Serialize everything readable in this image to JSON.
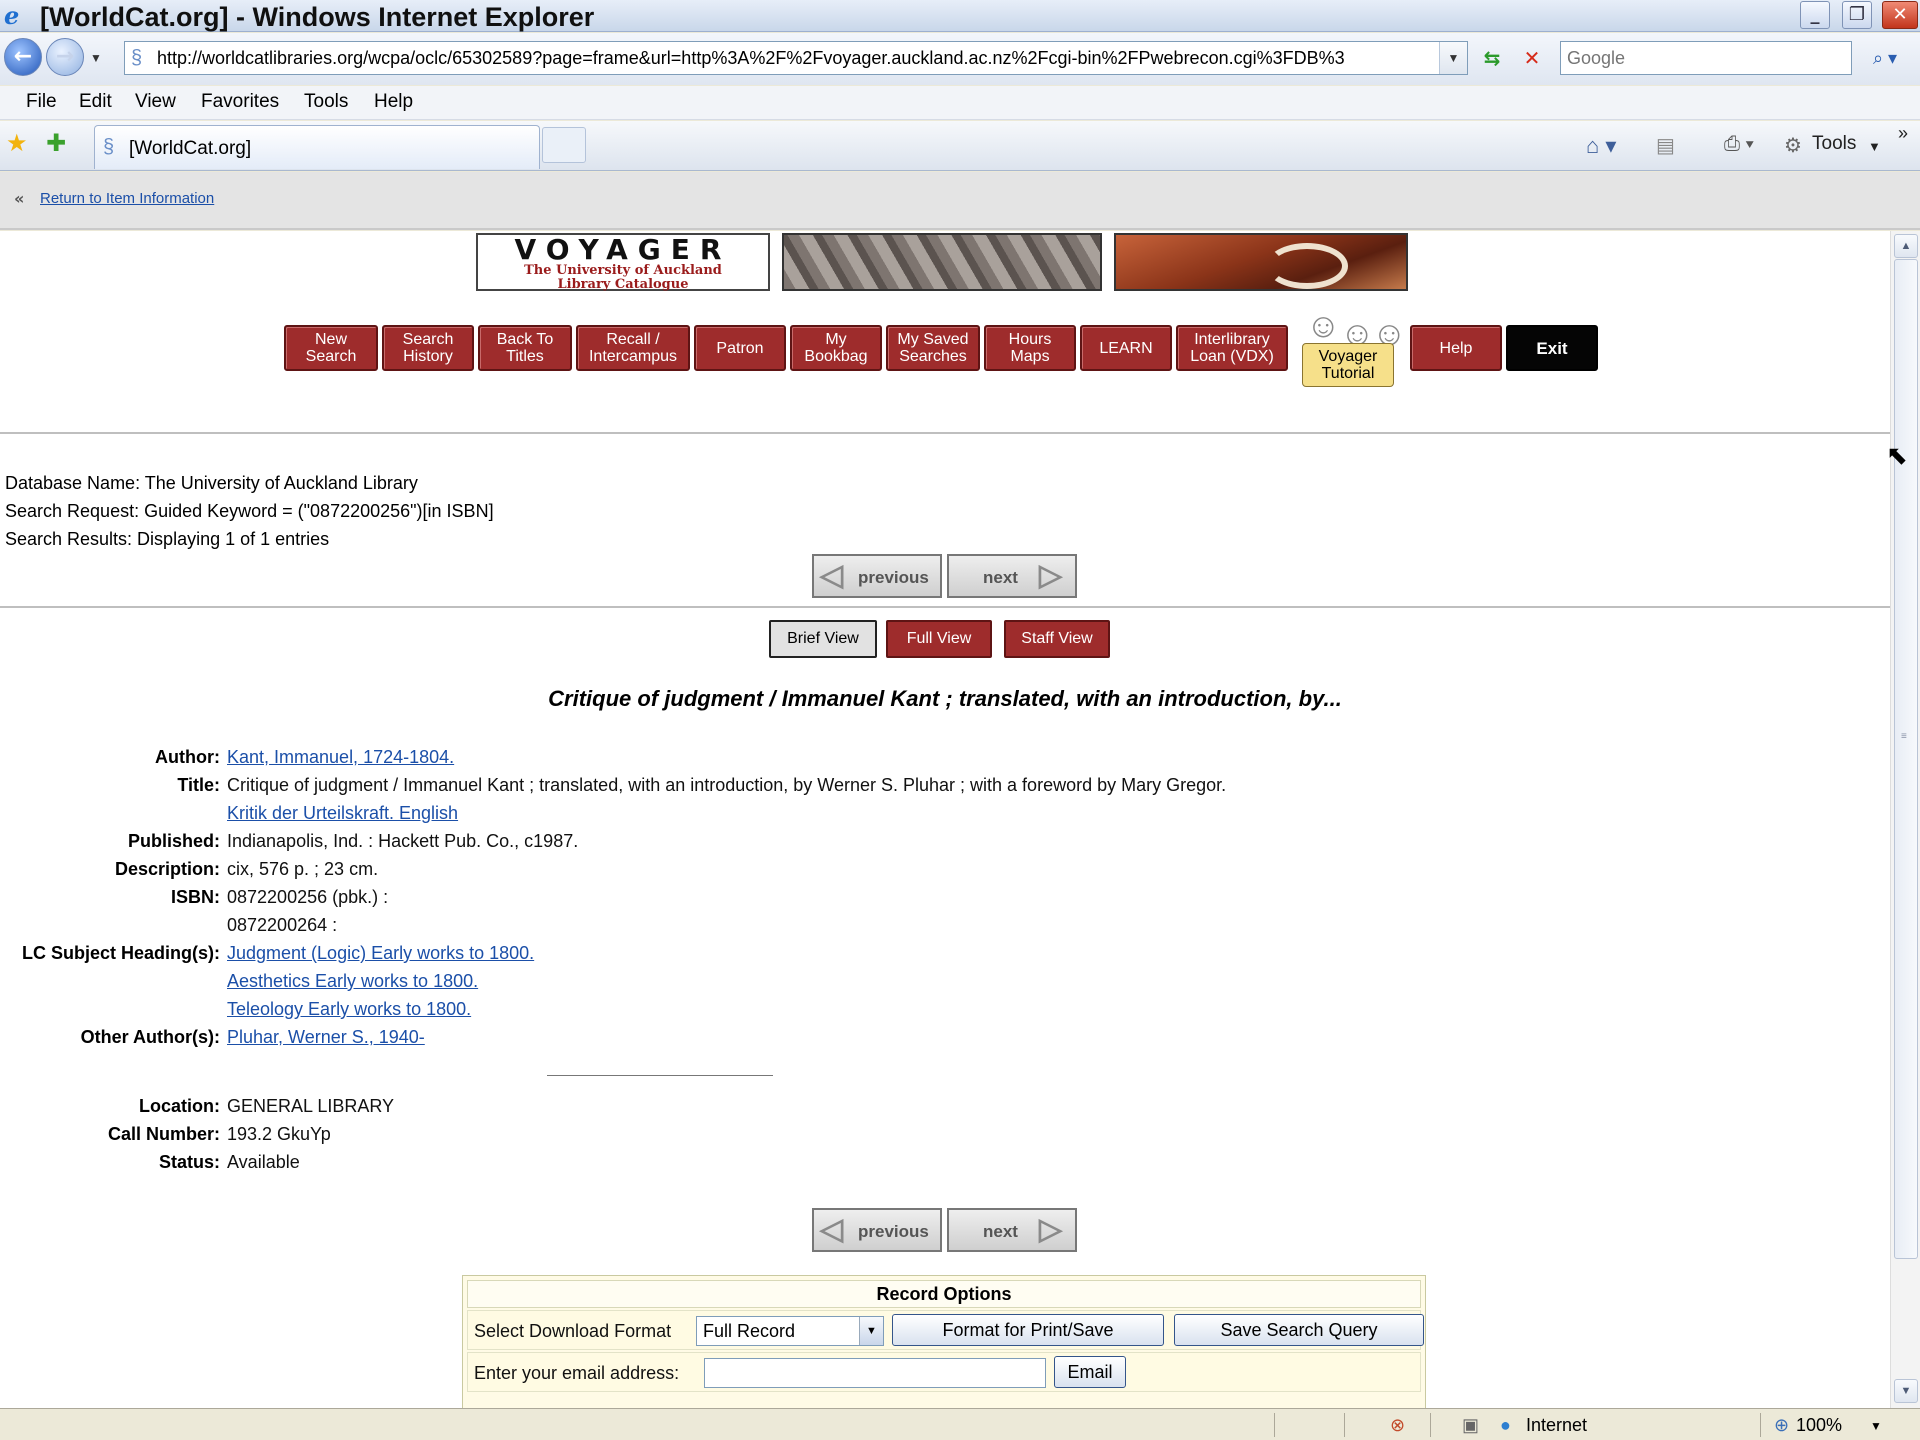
{
  "window": {
    "title": "[WorldCat.org] - Windows Internet Explorer"
  },
  "toolbar": {
    "url": "http://worldcatlibraries.org/wcpa/oclc/65302589?page=frame&url=http%3A%2F%2Fvoyager.auckland.ac.nz%2Fcgi-bin%2FPwebrecon.cgi%3FDB%3",
    "search_placeholder": "Google"
  },
  "menu": [
    "File",
    "Edit",
    "View",
    "Favorites",
    "Tools",
    "Help"
  ],
  "tab": {
    "label": "[WorldCat.org]"
  },
  "commandbar": {
    "tools_label": "Tools"
  },
  "frame_header": {
    "return_link": "Return to Item Information"
  },
  "banner": {
    "logo_title": "VOYAGER",
    "logo_sub1": "The University of Auckland",
    "logo_sub2": "Library Catalogue"
  },
  "nav": {
    "new_search": [
      "New",
      "Search"
    ],
    "search_history": [
      "Search",
      "History"
    ],
    "back_to_titles": [
      "Back To",
      "Titles"
    ],
    "recall": [
      "Recall /",
      "Intercampus"
    ],
    "patron": "Patron",
    "my_bookbag": [
      "My",
      "Bookbag"
    ],
    "my_saved_searches": [
      "My Saved",
      "Searches"
    ],
    "hours_maps": [
      "Hours",
      "Maps"
    ],
    "learn": "LEARN",
    "interlibrary_loan": [
      "Interlibrary",
      "Loan (VDX)"
    ],
    "voyager_tutorial": [
      "Voyager",
      "Tutorial"
    ],
    "help": "Help",
    "exit": "Exit"
  },
  "search_info": {
    "database": "Database Name: The University of Auckland Library",
    "request": "Search Request: Guided Keyword = (\"0872200256\")[in ISBN]",
    "results": "Search Results: Displaying 1 of 1 entries"
  },
  "pager": {
    "previous": "previous",
    "next": "next"
  },
  "views": {
    "brief": "Brief View",
    "full": "Full View",
    "staff": "Staff View"
  },
  "record": {
    "heading": "Critique of judgment / Immanuel Kant ; translated, with an introduction, by...",
    "labels": {
      "author": "Author:",
      "title": "Title:",
      "published": "Published:",
      "description": "Description:",
      "isbn": "ISBN:",
      "subjects": "LC Subject Heading(s):",
      "other_authors": "Other Author(s):",
      "location": "Location:",
      "call_number": "Call Number:",
      "status": "Status:"
    },
    "author": "Kant, Immanuel, 1724-1804.",
    "title": "Critique of judgment / Immanuel Kant ; translated, with an introduction, by Werner S. Pluhar ; with a foreword by Mary Gregor.",
    "uniform_title": "Kritik der Urteilskraft. English",
    "published": "Indianapolis, Ind. : Hackett Pub. Co., c1987.",
    "description": "cix, 576 p. ; 23 cm.",
    "isbn": [
      "0872200256 (pbk.) :",
      "0872200264 :"
    ],
    "subjects": [
      "Judgment (Logic) Early works to 1800.",
      "Aesthetics Early works to 1800.",
      "Teleology Early works to 1800."
    ],
    "other_authors": "Pluhar, Werner S., 1940-",
    "location": "GENERAL LIBRARY",
    "call_number": "193.2 GkuYp",
    "status": "Available"
  },
  "record_options": {
    "heading": "Record Options",
    "download_label": "Select Download Format",
    "download_value": "Full Record",
    "format_button": "Format for Print/Save",
    "save_query_button": "Save Search Query",
    "email_label": "Enter your email address:",
    "email_button": "Email"
  },
  "statusbar": {
    "zone": "Internet",
    "zoom": "100%"
  }
}
